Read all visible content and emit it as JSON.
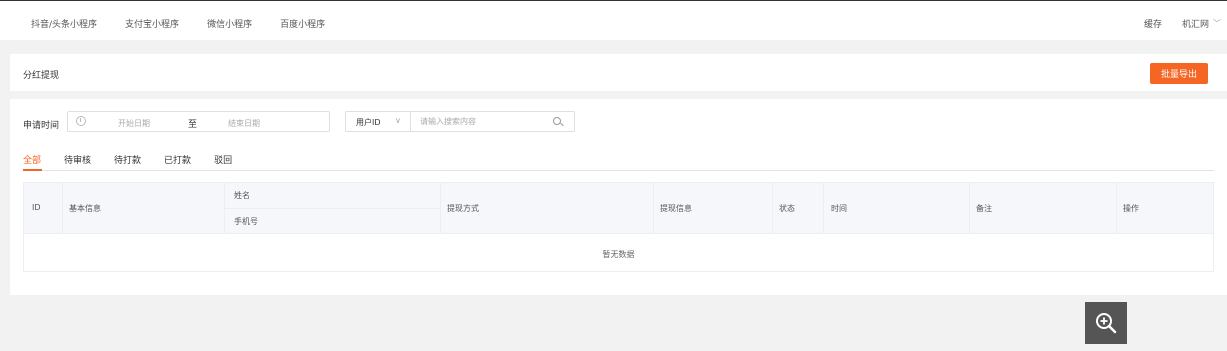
{
  "topnav": {
    "items": [
      "抖音/头条小程序",
      "支付宝小程序",
      "微信小程序",
      "百度小程序"
    ],
    "cache": "缓存",
    "user": "机汇网"
  },
  "header": {
    "title": "分红提现",
    "export_label": "批量导出"
  },
  "filter": {
    "label": "申请时间",
    "start_placeholder": "开始日期",
    "separator": "至",
    "end_placeholder": "结束日期",
    "select_value": "用户ID",
    "search_placeholder": "请输入搜索内容"
  },
  "tabs": [
    "全部",
    "待审核",
    "待打款",
    "已打款",
    "驳回"
  ],
  "table": {
    "headers": {
      "id": "ID",
      "basic": "基本信息",
      "name": "姓名",
      "phone": "手机号",
      "method": "提现方式",
      "info": "提现信息",
      "status": "状态",
      "time": "时间",
      "remark": "备注",
      "action": "操作"
    },
    "empty_text": "暂无数据"
  },
  "colors": {
    "accent": "#f56523"
  }
}
